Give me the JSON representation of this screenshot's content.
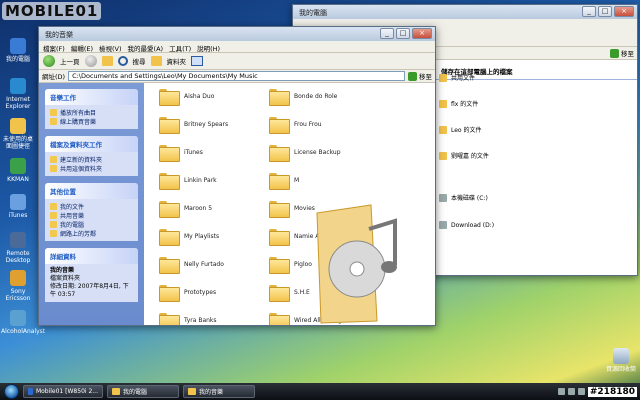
{
  "watermark": "MOBILE01",
  "stamp": "#218180",
  "desktop_icons": [
    {
      "label": "我的電腦"
    },
    {
      "label": "Internet Explorer"
    },
    {
      "label": "未使用的桌面圖捷徑"
    },
    {
      "label": "KKMAN"
    },
    {
      "label": "iTunes"
    },
    {
      "label": "Remote Desktop"
    },
    {
      "label": "Sony Ericsson"
    },
    {
      "label": "AlcoholAnalyst"
    }
  ],
  "recycle_bin": "資源回收筒",
  "back_window": {
    "title": "我的電腦",
    "header": "儲存在這部電腦上的檔案",
    "items": [
      "共用文件",
      "flx 的文件",
      "Leo 的文件",
      "劉曜嘉 的文件",
      "本機磁碟 (C:)",
      "Download (D:)"
    ],
    "go_label": "移至"
  },
  "front_window": {
    "title": "我的音樂",
    "menu": [
      "檔案(F)",
      "編輯(E)",
      "檢視(V)",
      "我的最愛(A)",
      "工具(T)",
      "說明(H)"
    ],
    "toolbar": {
      "back": "上一頁",
      "search": "搜尋",
      "folders": "資料夾"
    },
    "address_label": "網址(D)",
    "address_value": "C:\\Documents and Settings\\Leo\\My Documents\\My Music",
    "go_label": "移至",
    "panels": [
      {
        "title": "音樂工作",
        "items": [
          "播放所有曲目",
          "線上購買音樂"
        ]
      },
      {
        "title": "檔案及資料夾工作",
        "items": [
          "建立新的資料夾",
          "共用這個資料夾"
        ]
      },
      {
        "title": "其他位置",
        "items": [
          "我的文件",
          "共用音樂",
          "我的電腦",
          "網路上的芳鄰"
        ]
      }
    ],
    "details": {
      "title": "詳細資料",
      "name": "我的音樂",
      "type": "檔案資料夾",
      "modified": "修改日期: 2007年8月4日, 下午 03:57"
    },
    "folders": [
      "Aisha Duo",
      "Bonde do Role",
      "Britney Spears",
      "Frou Frou",
      "iTunes",
      "License Backup",
      "Linkin Park",
      "M",
      "Maroon 5",
      "Movies",
      "My Playlists",
      "Namie Amuro",
      "Nelly Furtado",
      "Pigloo",
      "Prototypes",
      "S.H.E",
      "Tyra Banks",
      "Wired All Wrong"
    ]
  },
  "taskbar": {
    "items": [
      "Mobile01 [W850i 2...",
      "我的電腦",
      "我的音樂"
    ]
  }
}
